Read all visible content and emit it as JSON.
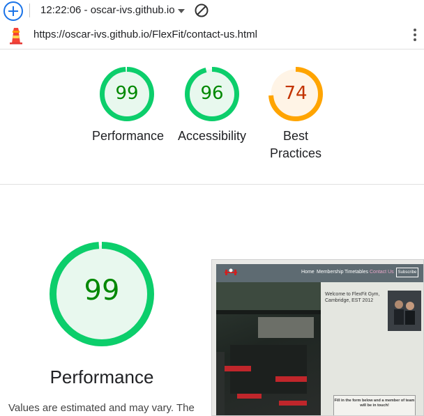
{
  "topbar": {
    "plus_icon": "plus-icon",
    "time_origin": "12:22:06 - oscar-ivs.github.io",
    "dropdown_icon": "triangle-down-icon",
    "block_icon": "block-icon"
  },
  "urlbar": {
    "logo_icon": "lighthouse-icon",
    "url": "https://oscar-ivs.github.io/FlexFit/contact-us.html",
    "menu_icon": "kebab-menu-icon"
  },
  "scores": [
    {
      "value": "99",
      "label": "Performance",
      "color": "#0cce6b",
      "bg": "#e8f8ee",
      "text_color": "#008800",
      "fraction": 0.99
    },
    {
      "value": "96",
      "label": "Accessibility",
      "color": "#0cce6b",
      "bg": "#e8f8ee",
      "text_color": "#008800",
      "fraction": 0.96
    },
    {
      "value": "74",
      "label1": "Best",
      "label2": "Practices",
      "color": "#ffa400",
      "bg": "#fff4e6",
      "text_color": "#c33300",
      "fraction": 0.74
    }
  ],
  "detail": {
    "score": "99",
    "fraction": 0.99,
    "color": "#0cce6b",
    "title": "Performance",
    "note": "Values are estimated and may vary. The"
  },
  "screenshot": {
    "nav": [
      "Home",
      "Membership",
      "Timetables",
      "Contact Us"
    ],
    "subscribe": "Subscribe",
    "welcome_title": "Welcome to FlexFit Gym, Cambridge, EST 2012",
    "form_heading": "Fill in the form below and a member of team will be in touch!"
  }
}
